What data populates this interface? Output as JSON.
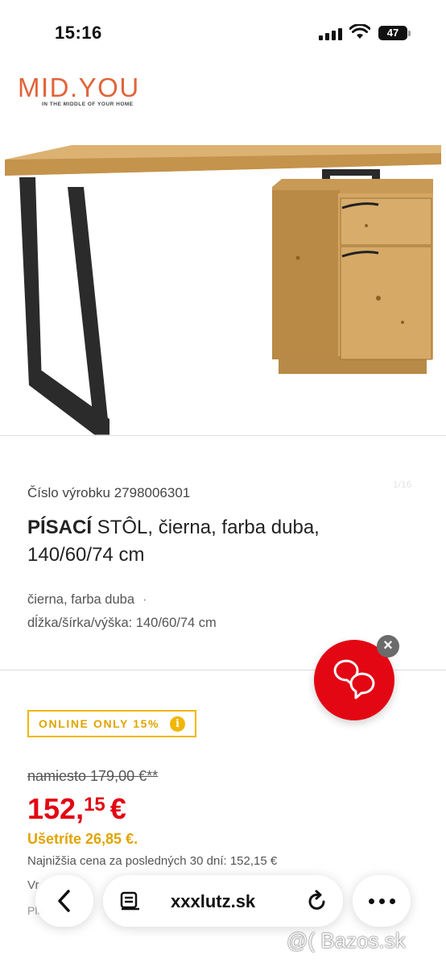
{
  "status": {
    "time": "15:16",
    "battery": "47"
  },
  "brand": {
    "name": "MID.YOU",
    "tagline": "IN THE MIDDLE OF YOUR HOME",
    "color": "#e2643a"
  },
  "product": {
    "sku_label": "Číslo výrobku 2798006301",
    "title_bold": "PÍSACÍ",
    "title_rest": " STÔL, čierna, farba duba, 140/60/74 cm",
    "attr_color": "čierna, farba duba",
    "attr_dot": "·",
    "attr_dims": "dĺžka/šírka/výška: 140/60/74 cm",
    "watermark": "1/16"
  },
  "promo": {
    "badge": "ONLINE ONLY 15%",
    "info_icon": "i"
  },
  "pricing": {
    "old_price": "namiesto 179,00 €**",
    "price_main": "152,",
    "price_cents": "15",
    "currency": "€",
    "savings": "Ušetríte 26,85 €.",
    "lowest": "Najnižšia cena za posledných 30 dní: 152,15 €",
    "partial_line1": "Vr",
    "partial_line2": "Pla"
  },
  "browser": {
    "url": "xxxlutz.sk"
  },
  "watermark": {
    "text": "@( Bazos.sk"
  },
  "colors": {
    "accent_red": "#e30613",
    "badge_yellow": "#f1b600"
  }
}
